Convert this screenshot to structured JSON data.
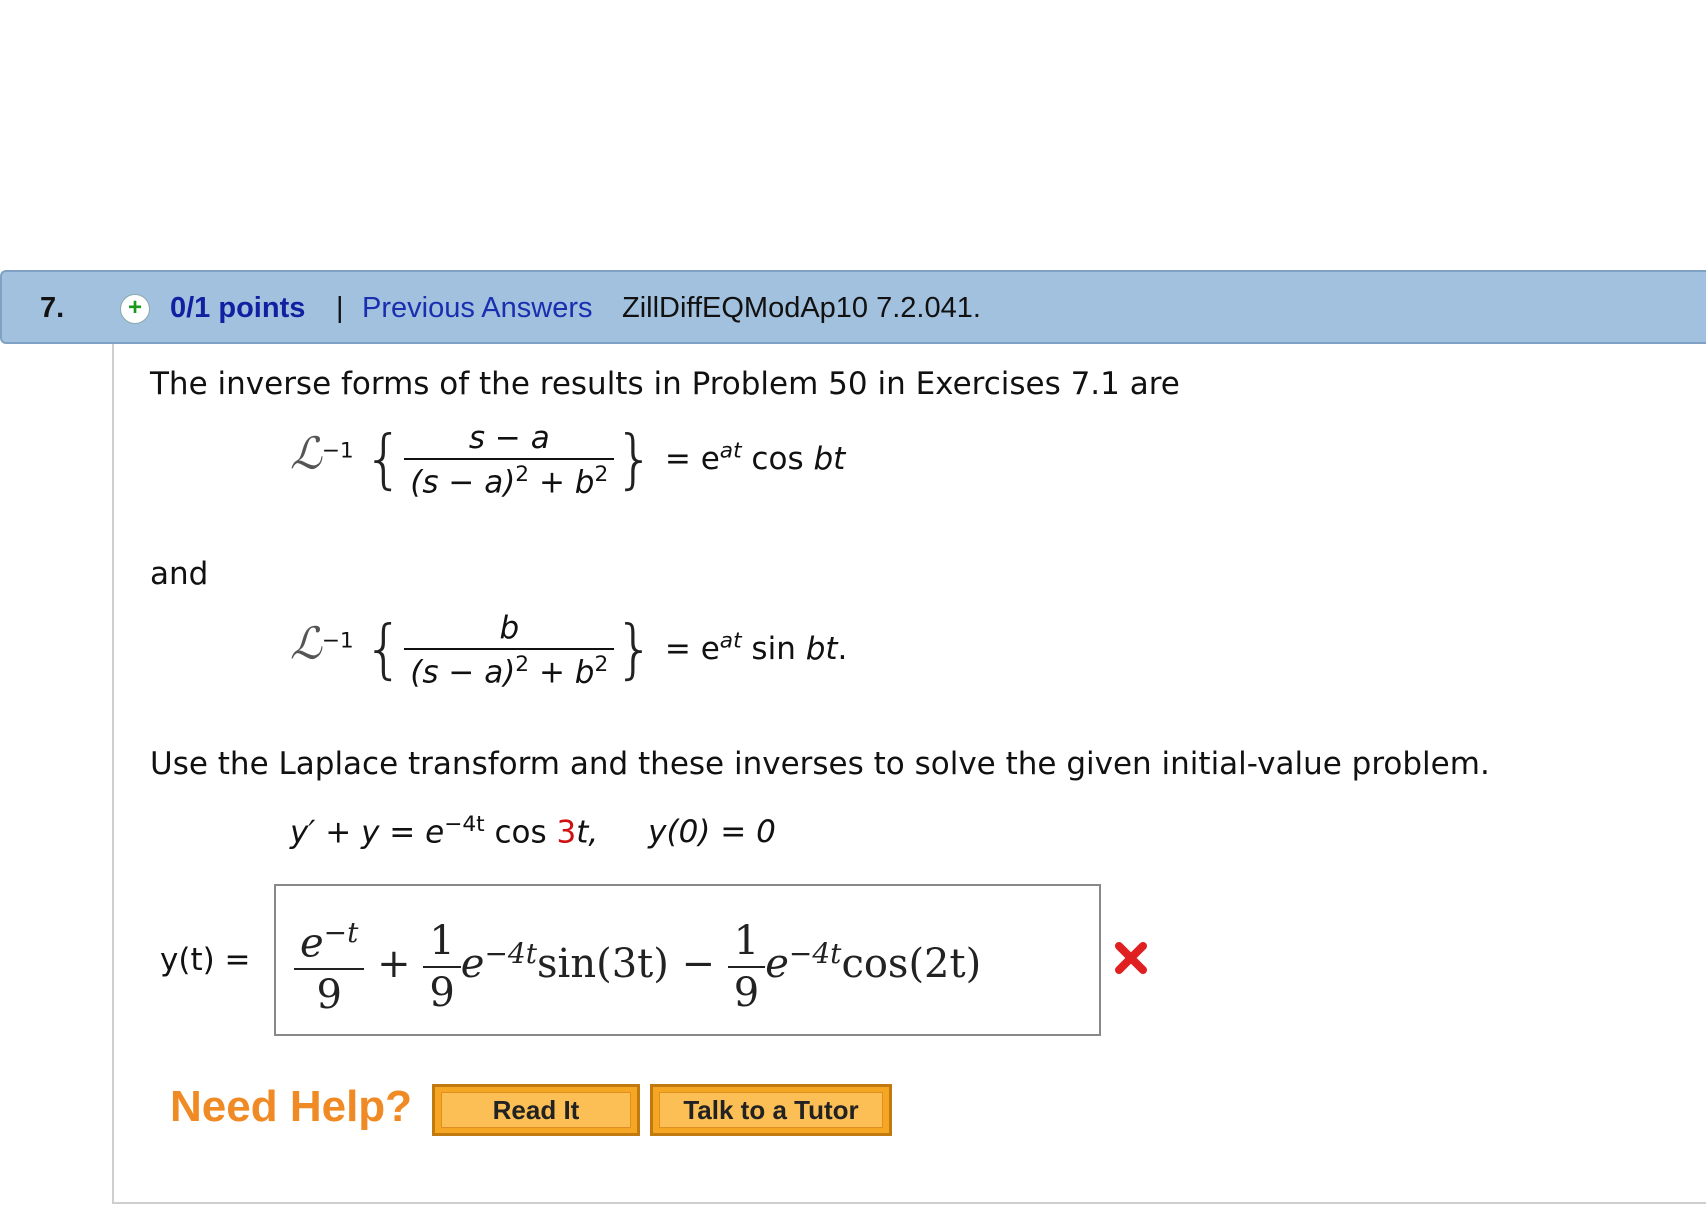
{
  "header": {
    "question_number": "7.",
    "points": "0/1 points",
    "separator": "|",
    "previous_answers": "Previous Answers",
    "question_ref": "ZillDiffEQModAp10 7.2.041."
  },
  "problem": {
    "intro": "The inverse forms of the results in Problem 50 in Exercises 7.1 are",
    "formula1": {
      "op": "ℒ",
      "op_sup": "−1",
      "numerator": "s − a",
      "den_open": "(s − a)",
      "den_exp": "2",
      "den_plus": " + b",
      "den_exp2": "2",
      "rhs_eq": "= e",
      "rhs_exp": "at",
      "rhs_func": " cos ",
      "rhs_var": "bt"
    },
    "and_text": "and",
    "formula2": {
      "op": "ℒ",
      "op_sup": "−1",
      "numerator": "b",
      "den_open": "(s − a)",
      "den_exp": "2",
      "den_plus": " + b",
      "den_exp2": "2",
      "rhs_eq": "= e",
      "rhs_exp": "at",
      "rhs_func": " sin ",
      "rhs_var": "bt",
      "rhs_end": "."
    },
    "instruction": "Use the Laplace transform and these inverses to solve the given initial-value problem.",
    "ivp": {
      "lhs": "y′ + y = e",
      "exp": "−4t",
      "cos": " cos ",
      "coef": "3",
      "t": "t,",
      "ic": "y(0) = 0"
    }
  },
  "answer": {
    "label": "y(t) =",
    "t1_num_base": "e",
    "t1_num_exp": "−t",
    "t1_den": "9",
    "plus": "+",
    "t2_num": "1",
    "t2_den": "9",
    "t2_e": "e",
    "t2_exp": "−4t",
    "t2_func": "sin(3t)",
    "minus": "−",
    "t3_num": "1",
    "t3_den": "9",
    "t3_e": "e",
    "t3_exp": "−4t",
    "t3_func": "cos(2t)",
    "status_icon": "x-mark-icon",
    "status_color": "#e02020"
  },
  "help": {
    "title": "Need Help?",
    "read_it": "Read It",
    "talk_tutor": "Talk to a Tutor"
  }
}
